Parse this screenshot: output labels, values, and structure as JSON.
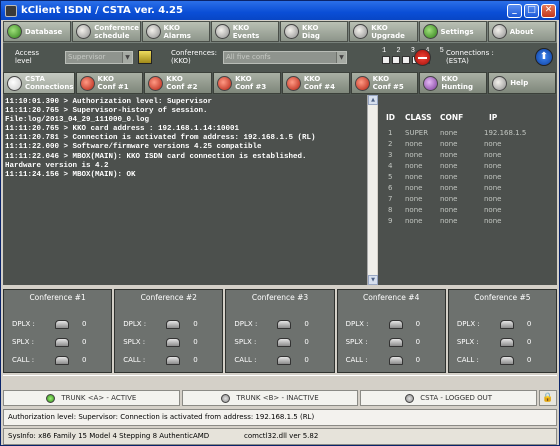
{
  "window": {
    "title": "kClient ISDN / CSTA ver. 4.25"
  },
  "toolbar": {
    "items": [
      {
        "label": "Database"
      },
      {
        "label": "Conference\nschedule"
      },
      {
        "label": "KKO\nAlarms"
      },
      {
        "label": "KKO\nEvents"
      },
      {
        "label": "KKO\nDiag"
      },
      {
        "label": "KKO\nUpgrade"
      },
      {
        "label": "Settings"
      },
      {
        "label": "About"
      }
    ]
  },
  "infobar": {
    "access_label": "Access\nlevel",
    "access_value": "Supervisor",
    "conferences_label": "Conferences:\n(KKO)",
    "conferences_value": "All five confs",
    "conf_numbers": "1 2 3 4 5",
    "connections_label": "Connections :\n(ESTA)"
  },
  "tabs": [
    {
      "label": "CSTA\nConnections"
    },
    {
      "label": "KKO\nConf #1"
    },
    {
      "label": "KKO\nConf #2"
    },
    {
      "label": "KKO\nConf #3"
    },
    {
      "label": "KKO\nConf #4"
    },
    {
      "label": "KKO\nConf #5"
    },
    {
      "label": "KKO\nHunting"
    },
    {
      "label": "Help"
    }
  ],
  "log": [
    "11:10:01.390 > Authorization level: Supervisor",
    "11:11:20.765 > Supervisor-history of session.",
    "File:log/2013_04_29_111000_0.log",
    "11:11:20.765 > KKO card address : 192.168.1.14:10001",
    "11:11:20.781 > Connection is activated from address: 192.168.1.5 (RL)",
    "11:11:22.000 > Software/firmware versions 4.25 compatible",
    "11:11:22.046 > MBOX(MAIN): KKO ISDN card connection is established.",
    "Hardware version is 4.2",
    "11:11:24.156 > MBOX(MAIN): OK"
  ],
  "id_table": {
    "headers": [
      "ID",
      "CLASS",
      "CONF",
      "IP"
    ],
    "rows": [
      [
        "1",
        "SUPER",
        "none",
        "192.168.1.5"
      ],
      [
        "2",
        "none",
        "none",
        "none"
      ],
      [
        "3",
        "none",
        "none",
        "none"
      ],
      [
        "4",
        "none",
        "none",
        "none"
      ],
      [
        "5",
        "none",
        "none",
        "none"
      ],
      [
        "6",
        "none",
        "none",
        "none"
      ],
      [
        "7",
        "none",
        "none",
        "none"
      ],
      [
        "8",
        "none",
        "none",
        "none"
      ],
      [
        "9",
        "none",
        "none",
        "none"
      ]
    ]
  },
  "conferences": [
    {
      "title": "Conference #1",
      "rows": [
        {
          "label": "DPLX :",
          "value": "0"
        },
        {
          "label": "SPLX :",
          "value": "0"
        },
        {
          "label": "CALL :",
          "value": "0"
        }
      ]
    },
    {
      "title": "Conference #2",
      "rows": [
        {
          "label": "DPLX :",
          "value": "0"
        },
        {
          "label": "SPLX :",
          "value": "0"
        },
        {
          "label": "CALL :",
          "value": "0"
        }
      ]
    },
    {
      "title": "Conference #3",
      "rows": [
        {
          "label": "DPLX :",
          "value": "0"
        },
        {
          "label": "SPLX :",
          "value": "0"
        },
        {
          "label": "CALL :",
          "value": "0"
        }
      ]
    },
    {
      "title": "Conference #4",
      "rows": [
        {
          "label": "DPLX :",
          "value": "0"
        },
        {
          "label": "SPLX :",
          "value": "0"
        },
        {
          "label": "CALL :",
          "value": "0"
        }
      ]
    },
    {
      "title": "Conference #5",
      "rows": [
        {
          "label": "DPLX :",
          "value": "0"
        },
        {
          "label": "SPLX :",
          "value": "0"
        },
        {
          "label": "CALL :",
          "value": "0"
        }
      ]
    }
  ],
  "trunks": [
    {
      "label": "TRUNK <A> - ACTIVE",
      "state": "on"
    },
    {
      "label": "TRUNK <B> - INACTIVE",
      "state": "off"
    },
    {
      "label": "CSTA - LOGGED OUT",
      "state": "off"
    }
  ],
  "status": {
    "line": "Authorization level: Supervisor: Connection is activated from address: 192.168.1.5 (RL)"
  },
  "sysinfo": {
    "cpu": "SysInfo: x86 Family 15 Model 4 Stepping 8 AuthenticAMD",
    "dll": "comctl32.dll ver 5.82"
  }
}
